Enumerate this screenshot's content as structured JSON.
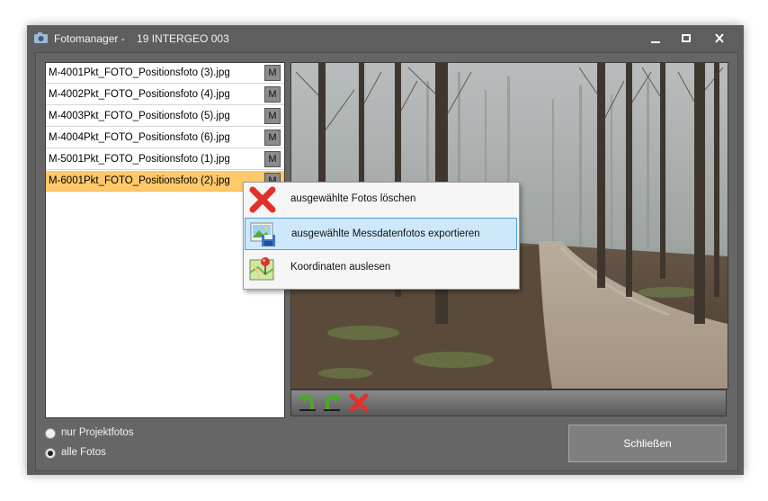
{
  "window": {
    "title": "Fotomanager -    19 INTERGEO 003",
    "icon": "camera-icon",
    "controls": {
      "minimize_icon": "minimize-icon",
      "maximize_icon": "maximize-icon",
      "close_icon": "close-icon"
    }
  },
  "file_list": {
    "items": [
      {
        "name": "M-4001Pkt_FOTO_Positionsfoto (3).jpg",
        "marker": "M",
        "selected": false
      },
      {
        "name": "M-4002Pkt_FOTO_Positionsfoto (4).jpg",
        "marker": "M",
        "selected": false
      },
      {
        "name": "M-4003Pkt_FOTO_Positionsfoto (5).jpg",
        "marker": "M",
        "selected": false
      },
      {
        "name": "M-4004Pkt_FOTO_Positionsfoto (6).jpg",
        "marker": "M",
        "selected": false
      },
      {
        "name": "M-5001Pkt_FOTO_Positionsfoto (1).jpg",
        "marker": "M",
        "selected": false
      },
      {
        "name": "M-6001Pkt_FOTO_Positionsfoto (2).jpg",
        "marker": "M",
        "selected": true
      }
    ]
  },
  "photo_toolbar": {
    "buttons": [
      {
        "icon": "rotate-left-icon"
      },
      {
        "icon": "rotate-right-icon"
      },
      {
        "icon": "delete-icon"
      }
    ]
  },
  "filter": {
    "options": [
      {
        "label": "nur Projektfotos",
        "checked": false
      },
      {
        "label": "alle Fotos",
        "checked": true
      }
    ]
  },
  "buttons": {
    "close_label": "Schließen"
  },
  "context_menu": {
    "items": [
      {
        "label": "ausgewählte Fotos löschen",
        "icon": "delete-x-icon",
        "highlighted": false
      },
      {
        "label": "ausgewählte Messdatenfotos exportieren",
        "icon": "export-photo-icon",
        "highlighted": true
      },
      {
        "label": "Koordinaten auslesen",
        "icon": "map-pin-icon",
        "highlighted": false
      }
    ]
  },
  "colors": {
    "window_bg": "#5e5e5e",
    "selected_row": "#ffc86b",
    "menu_highlight": "#cde8fb",
    "menu_highlight_border": "#4aa0e3",
    "delete_red": "#e0322c"
  }
}
